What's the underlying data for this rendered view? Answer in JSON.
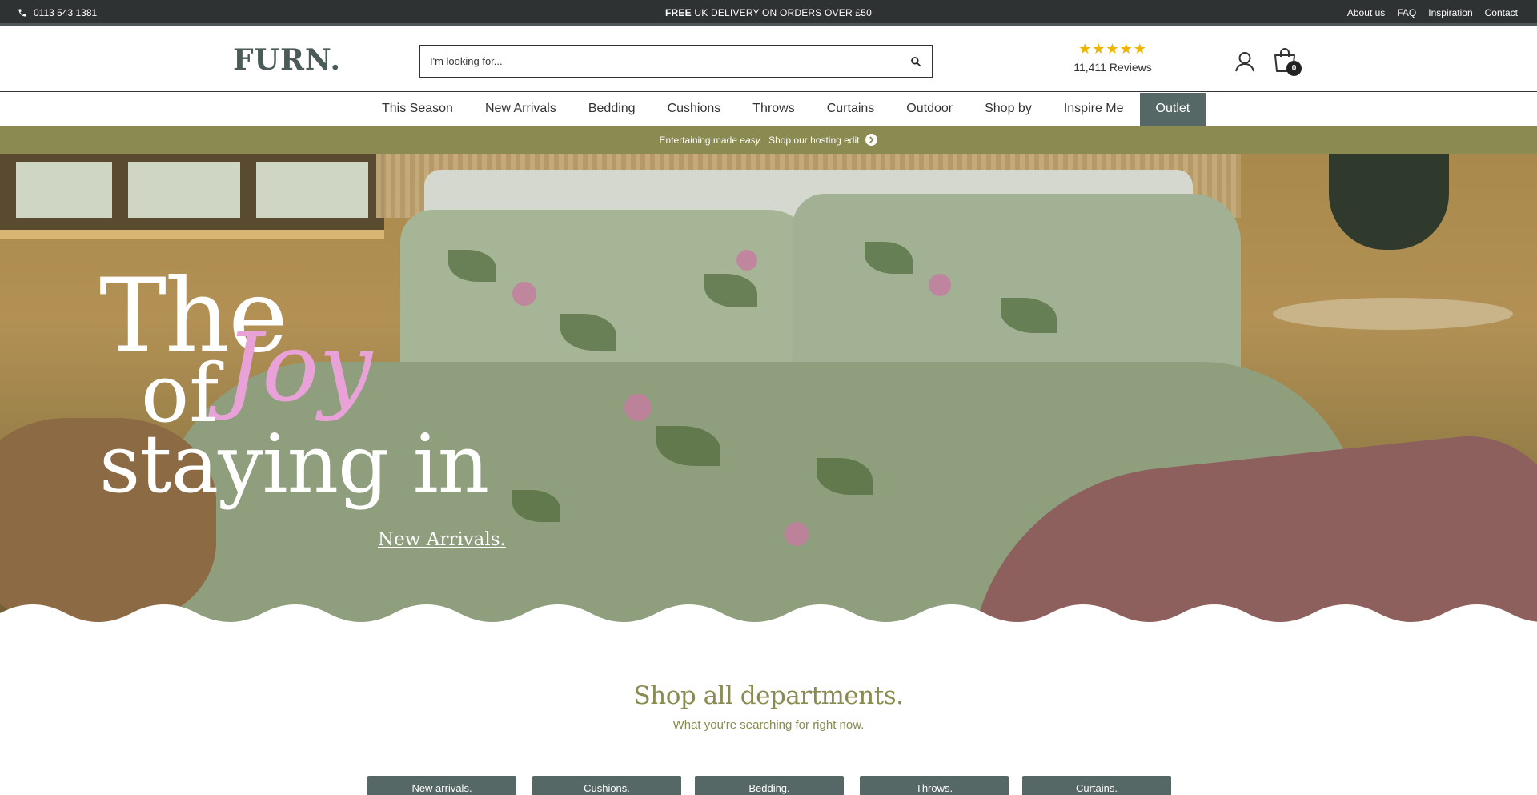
{
  "topbar": {
    "phone": "0113 543 1381",
    "promo_bold": "FREE",
    "promo_rest": " UK DELIVERY ON ORDERS OVER £50",
    "links": [
      "About us",
      "FAQ",
      "Inspiration",
      "Contact"
    ]
  },
  "header": {
    "logo": "FURN.",
    "search_placeholder": "I'm looking for...",
    "stars": "★★★★★",
    "reviews": "11,411 Reviews",
    "cart_count": "0"
  },
  "nav": {
    "items": [
      "This Season",
      "New Arrivals",
      "Bedding",
      "Cushions",
      "Throws",
      "Curtains",
      "Outdoor",
      "Shop by",
      "Inspire Me",
      "Outlet"
    ]
  },
  "announcement": {
    "text_start": "Entertaining made",
    "text_em": "easy.",
    "link": "Shop our hosting edit"
  },
  "hero": {
    "line_the": "The",
    "line_joy": "Joy",
    "line_of": "of",
    "line_staying": "staying in",
    "link": "New Arrivals."
  },
  "departments": {
    "title": "Shop all departments.",
    "subtitle": "What you're searching for right now.",
    "buttons": [
      "New arrivals.",
      "Cushions.",
      "Bedding.",
      "Throws.",
      "Curtains."
    ]
  },
  "colors": {
    "topbar_bg": "#2f3233",
    "brand_teal": "#566866",
    "olive": "#8a8a51",
    "joy_pink": "#e8a2d8",
    "star_gold": "#f0b400"
  },
  "icons": [
    "phone-icon",
    "search-icon",
    "star-icon",
    "account-icon",
    "cart-icon",
    "chevron-right-icon"
  ]
}
